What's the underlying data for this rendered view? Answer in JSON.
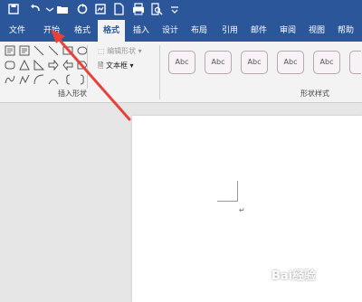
{
  "qat": {
    "icons": [
      "save-icon",
      "undo-icon",
      "open-icon",
      "refresh-icon",
      "screenshot-icon",
      "new-document-icon",
      "print-icon",
      "print-preview-icon",
      "customize-icon"
    ]
  },
  "tabs": [
    {
      "label": "文件",
      "active": false
    },
    {
      "label": "开始",
      "active": false
    },
    {
      "label": "格式",
      "active": false
    },
    {
      "label": "格式",
      "active": true
    },
    {
      "label": "插入",
      "active": false
    },
    {
      "label": "设计",
      "active": false
    },
    {
      "label": "布局",
      "active": false
    },
    {
      "label": "引用",
      "active": false
    },
    {
      "label": "邮件",
      "active": false
    },
    {
      "label": "审阅",
      "active": false
    },
    {
      "label": "视图",
      "active": false
    },
    {
      "label": "帮助",
      "active": false
    }
  ],
  "ribbon": {
    "insert_shapes": {
      "edit_shape_label": "编辑形状",
      "textbox_label": "文本框",
      "group_label": "插入形状"
    },
    "shape_styles": {
      "sample_text": "Abc",
      "group_label": "形状样式"
    }
  },
  "document": {
    "paragraph_mark": "↵"
  },
  "annotation": {
    "arrow_color": "#e8413c"
  },
  "watermark": "Bai经验"
}
